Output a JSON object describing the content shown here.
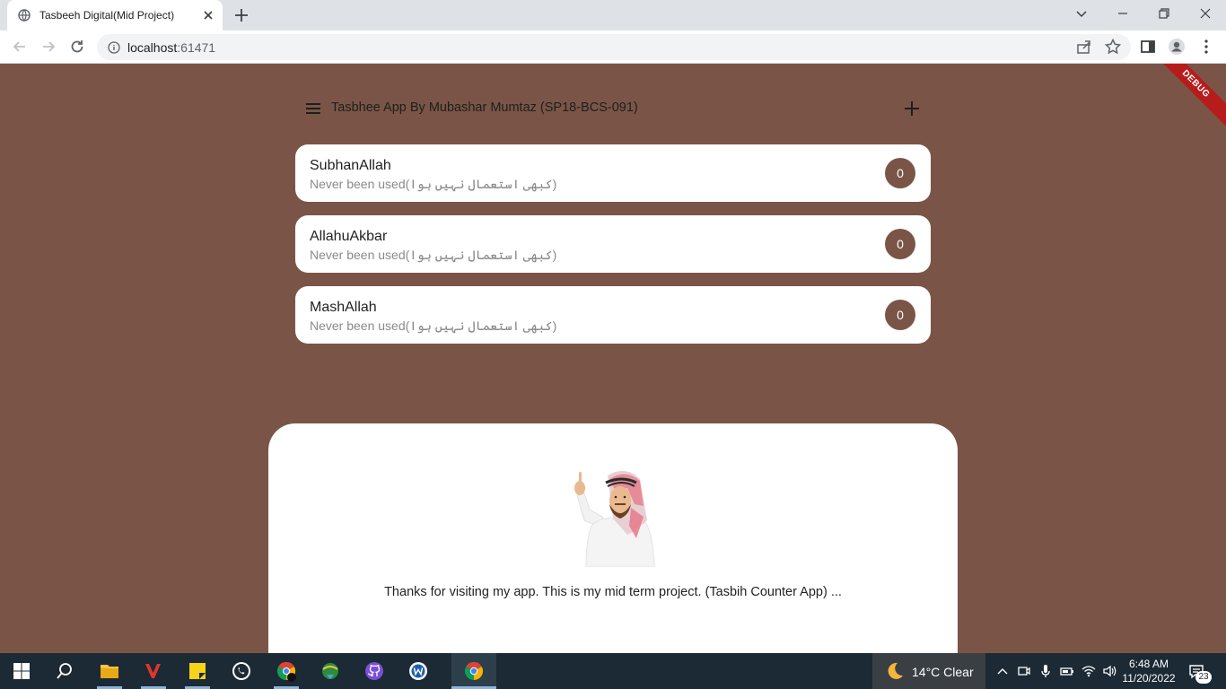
{
  "browser": {
    "tab_title": "Tasbeeh Digital(Mid Project)",
    "url_host": "localhost",
    "url_port": ":61471"
  },
  "app": {
    "title": "Tasbhee App By Mubashar Mumtaz (SP18-BCS-091)",
    "debug_banner": "DEBUG",
    "items": [
      {
        "name": "SubhanAllah",
        "subtitle": "Never been used(کبھی استعمال نہیں ہوا)",
        "count": "0"
      },
      {
        "name": "AllahuAkbar",
        "subtitle": "Never been used(کبھی استعمال نہیں ہوا)",
        "count": "0"
      },
      {
        "name": "MashAllah",
        "subtitle": "Never been used(کبھی استعمال نہیں ہوا)",
        "count": "0"
      }
    ],
    "footer_message": "Thanks for visiting my app. This is my mid term project. (Tasbih Counter App) ..."
  },
  "taskbar": {
    "weather": "14°C  Clear",
    "time": "6:48 AM",
    "date": "11/20/2022",
    "notification_count": "23"
  },
  "colors": {
    "app_background": "#7a5547",
    "card_background": "#ffffff",
    "counter_badge": "#7a5547",
    "debug_banner": "#b71c1c"
  },
  "icons": [
    "globe-icon",
    "close-icon",
    "plus-icon",
    "chevron-down-icon",
    "minimize-icon",
    "restore-icon",
    "back-icon",
    "forward-icon",
    "reload-icon",
    "info-icon",
    "share-icon",
    "star-icon",
    "sidepanel-icon",
    "profile-icon",
    "kebab-icon",
    "hamburger-menu-icon",
    "add-icon",
    "windows-start-icon",
    "search-icon",
    "file-explorer-icon",
    "whatsapp-icon",
    "chrome-icon",
    "github-icon"
  ]
}
